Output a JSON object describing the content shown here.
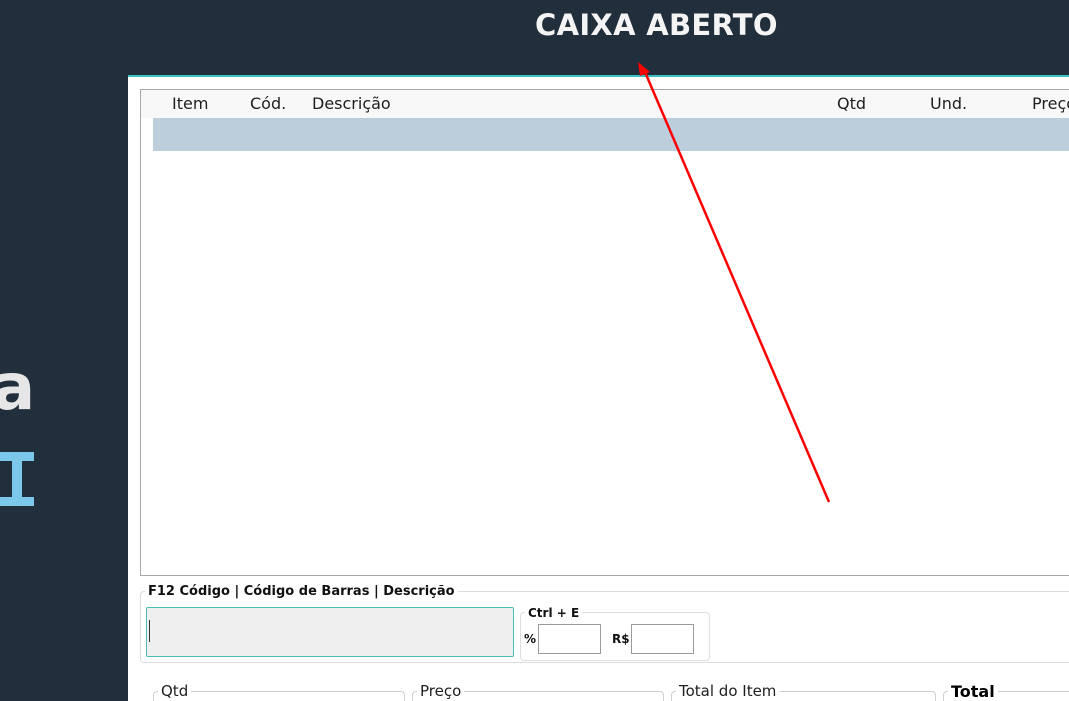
{
  "header": {
    "title": "CAIXA ABERTO"
  },
  "logo": {
    "partial_letter": "a"
  },
  "grid": {
    "columns": [
      "Item",
      "Cód.",
      "Descrição",
      "Qtd",
      "Und.",
      "Preço"
    ]
  },
  "search": {
    "legend": "F12  Código | Código de Barras | Descrição",
    "value": ""
  },
  "discount": {
    "legend": "Ctrl + E",
    "percent_label": "%",
    "currency_label": "R$",
    "percent_value": "",
    "currency_value": ""
  },
  "summary": {
    "qtd_label": "Qtd",
    "preco_label": "Preço",
    "total_item_label": "Total do Item",
    "total_label": "Total"
  },
  "colors": {
    "background": "#212e3c",
    "accent": "#3ac2c0",
    "selected_row": "#bccddb",
    "arrow": "#ff0000",
    "logo_i": "#7cc8ea"
  }
}
